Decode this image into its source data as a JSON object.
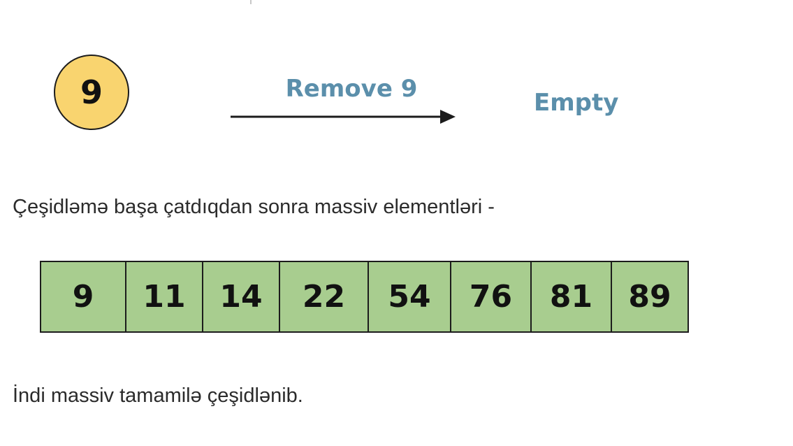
{
  "heap_node": {
    "value": "9"
  },
  "operation_label": "Remove 9",
  "result_label": "Empty",
  "paragraphs": {
    "after_sort": "Çeşidləmə başa çatdıqdan sonra massiv elementləri -",
    "conclusion": "İndi massiv tamamilə çeşidlənib."
  },
  "sorted_array": [
    "9",
    "11",
    "14",
    "22",
    "54",
    "76",
    "81",
    "89"
  ],
  "colors": {
    "node_fill": "#f9d46f",
    "label_blue": "#5b8fab",
    "array_fill": "#a8cd8f",
    "outline": "#1c1c1c"
  }
}
